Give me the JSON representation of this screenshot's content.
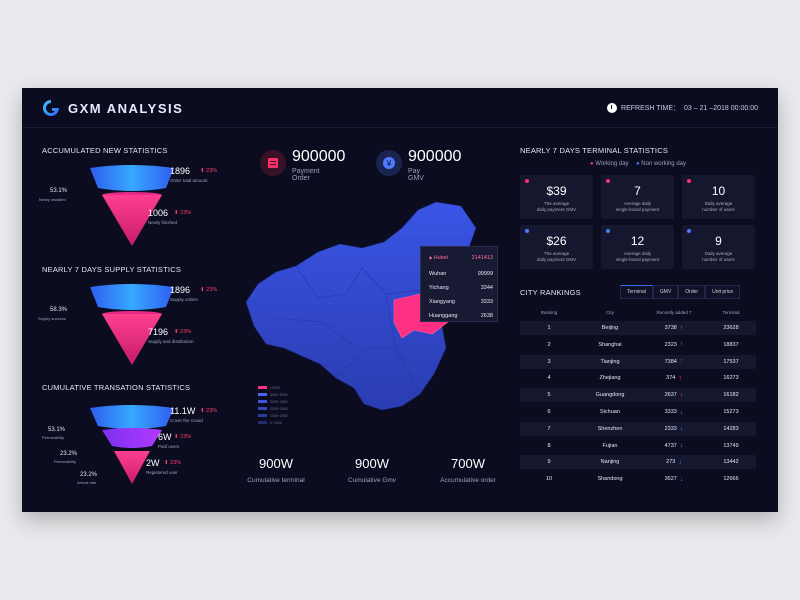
{
  "header": {
    "brand": "GXM ANALYSIS",
    "refresh_label": "REFRESH TIME：",
    "refresh_time": "03 – 21 –2018 00:00:00"
  },
  "accumulated": {
    "title": "ACCUMULATED NEW STATISTICS",
    "top": {
      "value": "1896",
      "pct": "23%",
      "label": "Order total amount"
    },
    "bottom": {
      "value": "1006",
      "pct": "23%",
      "label": "Newly finished"
    },
    "side": {
      "value": "53.1%",
      "label": "Newly installed"
    }
  },
  "supply": {
    "title": "NEARLY 7 DAYS SUPPLY STATISTICS",
    "top": {
      "value": "1896",
      "pct": "23%",
      "label": "Supply orders"
    },
    "bottom": {
      "value": "7196",
      "pct": "23%",
      "label": "Supply and distribution"
    },
    "side": {
      "value": "58.3%",
      "label": "Supply success"
    }
  },
  "cumulative": {
    "title": "CUMULATIVE TRANSATION STATISTICS",
    "l1": {
      "value": "11.1W",
      "pct": "23%",
      "label": "Cover the crowd"
    },
    "l2": {
      "value": "6W",
      "pct": "23%",
      "label": "Paid users"
    },
    "l3": {
      "value": "2W",
      "pct": "23%",
      "label": "Registered user"
    },
    "s1": {
      "value": "53.1%",
      "label": "Permeability"
    },
    "s2": {
      "value": "23.2%",
      "label": "Permeability"
    },
    "s3": {
      "value": "23.2%",
      "label": "Arrival rate"
    }
  },
  "center": {
    "payment": {
      "value": "900000",
      "label": "Payment Order"
    },
    "gmv": {
      "value": "900000",
      "label": "Pay GMV"
    },
    "tooltip": {
      "title": "Hubei",
      "title_value": "2141413",
      "rows": [
        {
          "city": "Wuhan",
          "value": "99999"
        },
        {
          "city": "Yichang",
          "value": "3344"
        },
        {
          "city": "Xiangyang",
          "value": "3333"
        },
        {
          "city": "Huanggang",
          "value": "2638"
        }
      ]
    },
    "legend": [
      {
        "label": ">5000",
        "color": "#ff2f83"
      },
      {
        "label": "4000~5000",
        "color": "#4a63f0"
      },
      {
        "label": "3000~4000",
        "color": "#3f55d8"
      },
      {
        "label": "2000~3000",
        "color": "#3546b8"
      },
      {
        "label": "1000~2000",
        "color": "#2b3a94"
      },
      {
        "label": "0~1000",
        "color": "#222c6e"
      }
    ],
    "cumulative": [
      {
        "value": "900W",
        "label": "Cumulative terminal"
      },
      {
        "value": "900W",
        "label": "Cumulative Gmv"
      },
      {
        "value": "700W",
        "label": "Accumulative order"
      }
    ]
  },
  "terminal": {
    "title": "NEARLY 7 DAYS TERMINAL STATISTICS",
    "legend_working": "Working day",
    "legend_non": "Non working day",
    "colors": {
      "working": "#ff2f6e",
      "non": "#4d7bff"
    },
    "cards": [
      {
        "value": "$39",
        "line1": "The average",
        "line2": "daily payment GMV",
        "type": "working"
      },
      {
        "value": "7",
        "line1": "Average daily",
        "line2": "single-board payment",
        "type": "working"
      },
      {
        "value": "10",
        "line1": "Daily average",
        "line2": "number of users",
        "type": "working"
      },
      {
        "value": "$26",
        "line1": "The average",
        "line2": "daily payment GMV",
        "type": "non"
      },
      {
        "value": "12",
        "line1": "Average daily",
        "line2": "single-board payment",
        "type": "non"
      },
      {
        "value": "9",
        "line1": "Daily average",
        "line2": "number of users",
        "type": "non"
      }
    ]
  },
  "rankings": {
    "title": "CITY RANKINGS",
    "tabs": [
      "Terminal",
      "GMV",
      "Order",
      "Unit price"
    ],
    "headers": [
      "Ranking",
      "City",
      "Recently added 7",
      "Terminal"
    ],
    "rows": [
      {
        "rank": "1",
        "city": "Beijing",
        "added": "3738",
        "dir": "up",
        "terminal": "23628"
      },
      {
        "rank": "2",
        "city": "Shanghai",
        "added": "2323",
        "dir": "up",
        "terminal": "18837"
      },
      {
        "rank": "3",
        "city": "Tianjing",
        "added": "7384",
        "dir": "up",
        "terminal": "17537"
      },
      {
        "rank": "4",
        "city": "Zhejiang",
        "added": "374",
        "dir": "up",
        "terminal": "16273"
      },
      {
        "rank": "5",
        "city": "Guangdong",
        "added": "2637",
        "dir": "up",
        "terminal": "16182"
      },
      {
        "rank": "6",
        "city": "Sichuan",
        "added": "3333",
        "dir": "down",
        "terminal": "15273"
      },
      {
        "rank": "7",
        "city": "Shenzhen",
        "added": "2333",
        "dir": "down",
        "terminal": "14283"
      },
      {
        "rank": "8",
        "city": "Fujian",
        "added": "4737",
        "dir": "down",
        "terminal": "13749"
      },
      {
        "rank": "9",
        "city": "Nanjing",
        "added": "273",
        "dir": "down",
        "terminal": "13442"
      },
      {
        "rank": "10",
        "city": "Shandong",
        "added": "3627",
        "dir": "down",
        "terminal": "12666"
      }
    ]
  },
  "icons": {
    "arrow_up": "↑",
    "arrow_down": "↓",
    "pct_up": "⬆",
    "side_toggle": "›"
  }
}
